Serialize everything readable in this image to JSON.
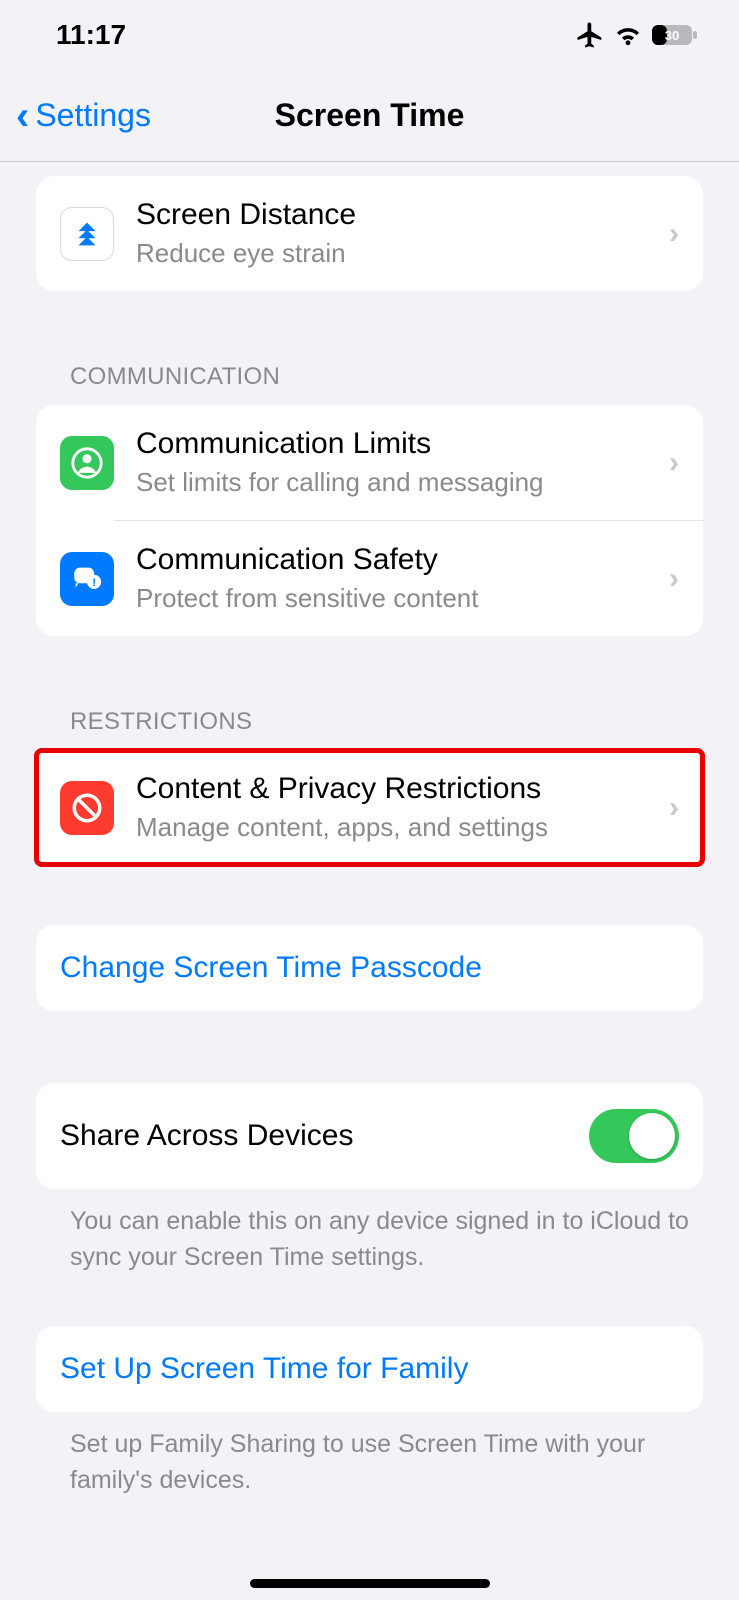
{
  "status": {
    "time": "11:17",
    "battery": "30"
  },
  "nav": {
    "back": "Settings",
    "title": "Screen Time"
  },
  "rows": {
    "screen_distance": {
      "title": "Screen Distance",
      "sub": "Reduce eye strain"
    },
    "comm_header": "COMMUNICATION",
    "comm_limits": {
      "title": "Communication Limits",
      "sub": "Set limits for calling and messaging"
    },
    "comm_safety": {
      "title": "Communication Safety",
      "sub": "Protect from sensitive content"
    },
    "restr_header": "RESTRICTIONS",
    "content_privacy": {
      "title": "Content & Privacy Restrictions",
      "sub": "Manage content, apps, and settings"
    },
    "change_passcode": "Change Screen Time Passcode",
    "share_devices": {
      "title": "Share Across Devices",
      "on": true
    },
    "share_footer": "You can enable this on any device signed in to iCloud to sync your Screen Time settings.",
    "family_setup": "Set Up Screen Time for Family",
    "family_footer": "Set up Family Sharing to use Screen Time with your family's devices."
  }
}
